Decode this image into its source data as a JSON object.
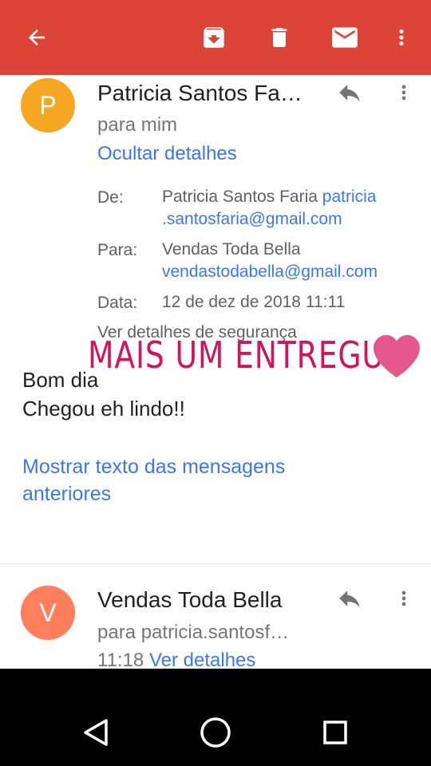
{
  "colors": {
    "toolbar": "#db4437",
    "link": "#3b78e7",
    "avatar_p": "#f5a623",
    "avatar_v": "#ff7f5c",
    "overlay_text": "#d4145a",
    "heart": "#e4578a"
  },
  "toolbar": {
    "icons": [
      "back-arrow-icon",
      "archive-icon",
      "delete-icon",
      "mail-icon",
      "more-vert-icon"
    ]
  },
  "message1": {
    "avatar_letter": "P",
    "sender": "Patricia Santos Fa…",
    "to": "para mim",
    "hide_details": "Ocultar detalhes",
    "details": {
      "from_label": "De:",
      "from_name": "Patricia Santos Faria",
      "from_email_1": "patricia",
      "from_email_2": ".santosfaria@gmail.com",
      "to_label": "Para:",
      "to_name": "Vendas Toda Bella",
      "to_email": "vendastodabella@gmail.com",
      "date_label": "Data:",
      "date_value": "12 de dez de 2018 11:11",
      "security_link": "Ver detalhes de segurança"
    },
    "body_line_1": "Bom dia",
    "body_line_2": "Chegou eh lindo!!",
    "show_previous": "Mostrar texto das mensagens anteriores"
  },
  "message2": {
    "avatar_letter": "V",
    "sender": "Vendas Toda Bella",
    "to": "para patricia.santosf…",
    "time": "11:18",
    "details_link": "Ver detalhes"
  },
  "overlay": {
    "text": "MAIS UM ENTREGUE"
  },
  "navbar": {
    "icons": [
      "back-triangle-icon",
      "home-circle-icon",
      "recents-square-icon"
    ]
  }
}
